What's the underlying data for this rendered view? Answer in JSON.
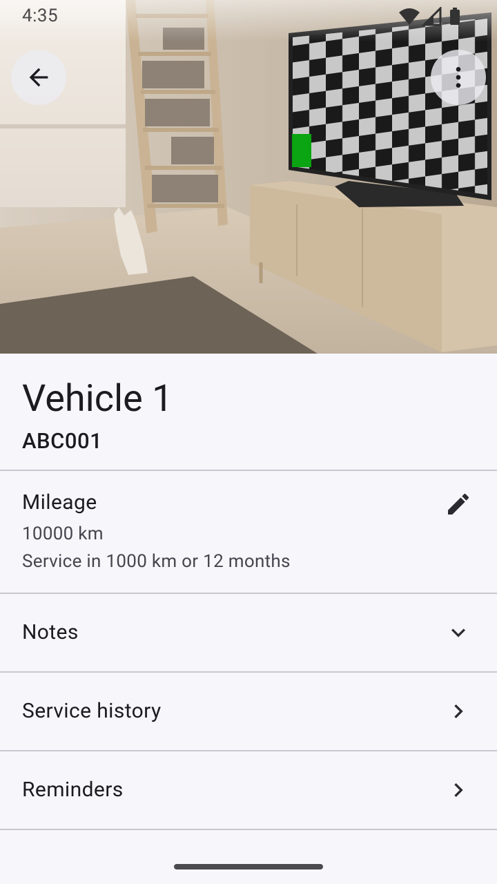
{
  "status_bar": {
    "time": "4:35"
  },
  "vehicle": {
    "name": "Vehicle 1",
    "plate": "ABC001"
  },
  "mileage": {
    "title": "Mileage",
    "value": "10000 km",
    "service_note": "Service in 1000 km or 12 months"
  },
  "sections": {
    "notes": "Notes",
    "service_history": "Service history",
    "reminders": "Reminders"
  },
  "icons": {
    "back": "arrow-back-icon",
    "more": "more-vert-icon",
    "edit": "pencil-icon",
    "expand": "chevron-down-icon",
    "navigate": "chevron-right-icon"
  },
  "colors": {
    "background": "#f7f6fb",
    "text_primary": "#1c1b20",
    "text_secondary": "#46454d",
    "divider": "#c9c7cf"
  }
}
